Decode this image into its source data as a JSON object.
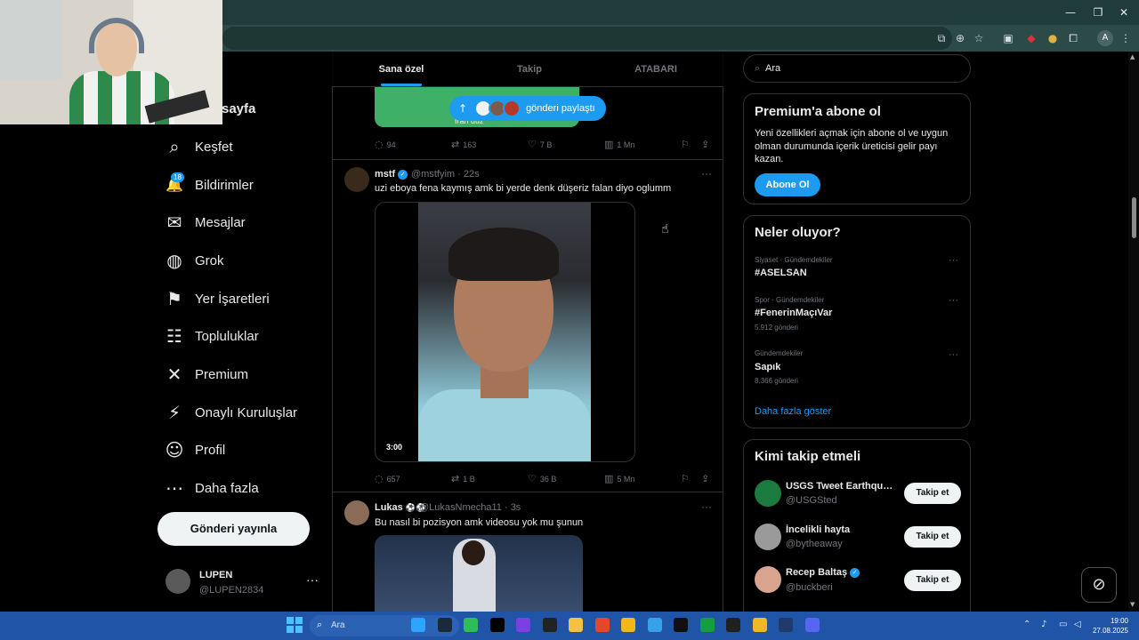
{
  "browser": {
    "window_controls": [
      "—",
      "❐",
      "✕"
    ],
    "toolbar_icons": [
      "cast-icon",
      "zoom-icon",
      "star-icon",
      "extension-icon",
      "shield-icon",
      "puzzle-icon"
    ],
    "profile_initial": "A",
    "menu": "⋮"
  },
  "nav": {
    "home_partial": "sayfa",
    "notifications_badge": "18",
    "items": [
      {
        "label": "Keşfet",
        "icon": "search-icon",
        "glyph": "⌕"
      },
      {
        "label": "Bildirimler",
        "icon": "bell-icon",
        "glyph": "🔔"
      },
      {
        "label": "Mesajlar",
        "icon": "mail-icon",
        "glyph": "✉"
      },
      {
        "label": "Grok",
        "icon": "grok-icon",
        "glyph": "◍"
      },
      {
        "label": "Yer İşaretleri",
        "icon": "bookmark-icon",
        "glyph": "⚑"
      },
      {
        "label": "Topluluklar",
        "icon": "communities-icon",
        "glyph": "☷"
      },
      {
        "label": "Premium",
        "icon": "x-logo-icon",
        "glyph": "✕"
      },
      {
        "label": "Onaylı Kuruluşlar",
        "icon": "lightning-icon",
        "glyph": "⚡"
      },
      {
        "label": "Profil",
        "icon": "profile-icon",
        "glyph": "☺"
      },
      {
        "label": "Daha fazla",
        "icon": "more-circle-icon",
        "glyph": "⋯"
      }
    ],
    "post_button": "Gönderi yayınla",
    "profile": {
      "name": "LUPEN",
      "handle": "@LUPEN2834",
      "more": "···"
    }
  },
  "feed": {
    "tabs": [
      "Sana özel",
      "Takip",
      "ATABARI"
    ],
    "active_tab": "Sana özel",
    "share_pill": "gönderi paylaştı",
    "prev_media_caption": "İran duz",
    "prev_actions": {
      "reply": "94",
      "retweet": "163",
      "like": "7 B",
      "views": "1 Mn"
    },
    "tweets": [
      {
        "name": "mstf",
        "handle": "@mstfyim",
        "time": "22s",
        "text": "uzi eboya fena kaymış amk bi yerde denk düşeriz falan diyo oglumm",
        "video_duration": "3:00",
        "actions": {
          "reply": "657",
          "retweet": "1 B",
          "like": "36 B",
          "views": "5 Mn"
        }
      },
      {
        "name": "Lukas",
        "name_suffix": "⚽⚽",
        "handle": "@LukasNmecha11",
        "time": "3s",
        "text": "Bu nasıl bi pozisyon amk videosu yok mu şunun"
      }
    ]
  },
  "right": {
    "search_placeholder": "Ara",
    "premium": {
      "title": "Premium'a abone ol",
      "text": "Yeni özellikleri açmak için abone ol ve uygun olman durumunda içerik üreticisi gelir payı kazan.",
      "button": "Abone Ol"
    },
    "trends": {
      "title": "Neler oluyor?",
      "items": [
        {
          "meta": "Siyaset · Gündemdekiler",
          "name": "#ASELSAN",
          "count": ""
        },
        {
          "meta": "Spor · Gündemdekiler",
          "name": "#FenerinMaçıVar",
          "count": "5.912 gönderi"
        },
        {
          "meta": "Gündemdekiler",
          "name": "Sapık",
          "count": "8.366 gönderi"
        }
      ],
      "show_more": "Daha fazla göster"
    },
    "who_to_follow": {
      "title": "Kimi takip etmeli",
      "items": [
        {
          "name": "USGS Tweet Earthquake Dispatch",
          "handle": "@USGSted",
          "button": "Takip et",
          "color": "#1b7a3d"
        },
        {
          "name": "İncelikli hayta",
          "handle": "@bytheaway",
          "button": "Takip et",
          "color": "#9a9a9a"
        },
        {
          "name": "Recep Baltaş",
          "handle": "@buckberi",
          "button": "Takip et",
          "color": "#d9a48d"
        }
      ]
    }
  },
  "taskbar": {
    "search_placeholder": "Ara",
    "time": "19:00",
    "date": "27.08.2025",
    "apps": [
      "#2fa4ff",
      "#1a2a3a",
      "#2ebd59",
      "#000000",
      "#7b3fe4",
      "#222222",
      "#f6c143",
      "#e6452e",
      "#f3b61b",
      "#35a1e8",
      "#101010",
      "#159d3e",
      "#202020",
      "#f2b824",
      "#1f3a6b",
      "#5865f2"
    ]
  }
}
